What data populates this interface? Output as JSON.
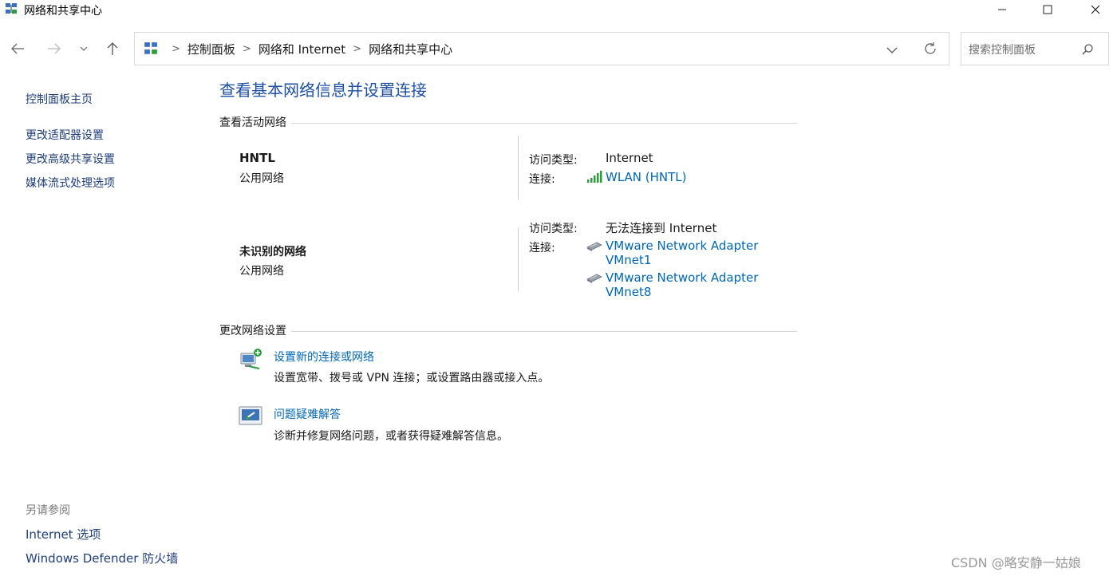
{
  "window": {
    "title": "网络和共享中心",
    "minimize_icon": "minimize-icon",
    "maximize_icon": "maximize-icon",
    "close_icon": "close-icon"
  },
  "nav": {
    "back": "←",
    "forward": "→",
    "history": "⌄",
    "up": "↑"
  },
  "address": {
    "crumbs": [
      "控制面板",
      "网络和 Internet",
      "网络和共享中心"
    ],
    "dropdown_icon": "chevron-down-icon",
    "refresh_icon": "refresh-icon"
  },
  "search": {
    "placeholder": "搜索控制面板",
    "icon": "search-icon"
  },
  "sidebar": {
    "home": "控制面板主页",
    "items": [
      "更改适配器设置",
      "更改高级共享设置",
      "媒体流式处理选项"
    ],
    "see_also_heading": "另请参阅",
    "see_also": [
      "Internet 选项",
      "Windows Defender 防火墙"
    ]
  },
  "main": {
    "title": "查看基本网络信息并设置连接",
    "active_networks_label": "查看活动网络",
    "networks": [
      {
        "name": "HNTL",
        "category": "公用网络",
        "access_type_label": "访问类型:",
        "access_type": "Internet",
        "connections_label": "连接:",
        "connections": [
          "WLAN (HNTL)"
        ]
      },
      {
        "name": "未识别的网络",
        "category": "公用网络",
        "access_type_label": "访问类型:",
        "access_type": "无法连接到 Internet",
        "connections_label": "连接:",
        "connections": [
          "VMware Network Adapter",
          "VMnet1",
          "VMware Network Adapter",
          "VMnet8"
        ]
      }
    ],
    "change_settings_label": "更改网络设置",
    "tasks": [
      {
        "title": "设置新的连接或网络",
        "desc": "设置宽带、拨号或 VPN 连接；或设置路由器或接入点。",
        "icon": "new-connection-icon"
      },
      {
        "title": "问题疑难解答",
        "desc": "诊断并修复网络问题，或者获得疑难解答信息。",
        "icon": "troubleshoot-icon"
      }
    ]
  },
  "watermark": "CSDN @略安静一姑娘"
}
